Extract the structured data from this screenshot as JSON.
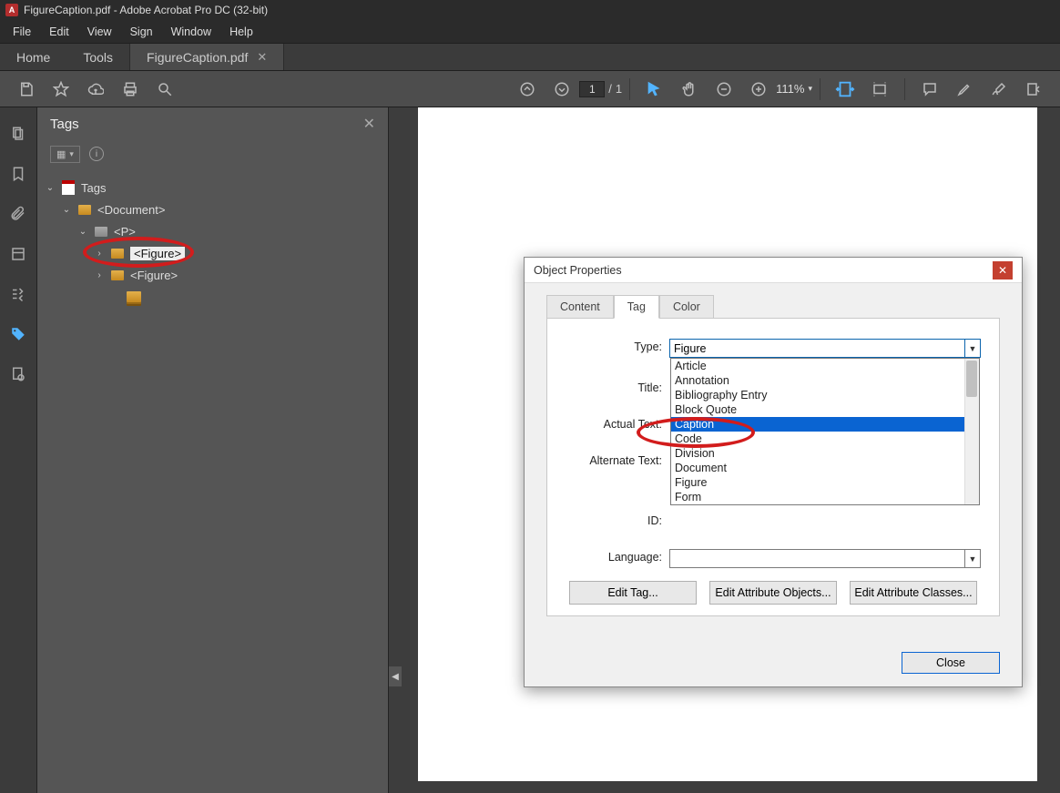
{
  "titlebar": {
    "text": "FigureCaption.pdf - Adobe Acrobat Pro DC (32-bit)"
  },
  "menu": {
    "file": "File",
    "edit": "Edit",
    "view": "View",
    "sign": "Sign",
    "window": "Window",
    "help": "Help"
  },
  "tabs": {
    "home": "Home",
    "tools": "Tools",
    "file": "FigureCaption.pdf"
  },
  "toolbar": {
    "page_current": "1",
    "page_sep": "/",
    "page_total": "1",
    "zoom": "111%"
  },
  "panel": {
    "title": "Tags",
    "root": "Tags",
    "doc": "<Document>",
    "p": "<P>",
    "fig1": "<Figure>",
    "fig2": "<Figure>"
  },
  "dialog": {
    "title": "Object Properties",
    "tabs": {
      "content": "Content",
      "tag": "Tag",
      "color": "Color"
    },
    "labels": {
      "type": "Type:",
      "title": "Title:",
      "actual": "Actual Text:",
      "alt": "Alternate Text:",
      "id": "ID:",
      "lang": "Language:"
    },
    "type_value": "Figure",
    "options": [
      "Article",
      "Annotation",
      "Bibliography Entry",
      "Block Quote",
      "Caption",
      "Code",
      "Division",
      "Document",
      "Figure",
      "Form"
    ],
    "selected_option": "Caption",
    "buttons": {
      "edit_tag": "Edit Tag...",
      "edit_attr_obj": "Edit Attribute Objects...",
      "edit_attr_cls": "Edit Attribute Classes..."
    },
    "close": "Close"
  }
}
